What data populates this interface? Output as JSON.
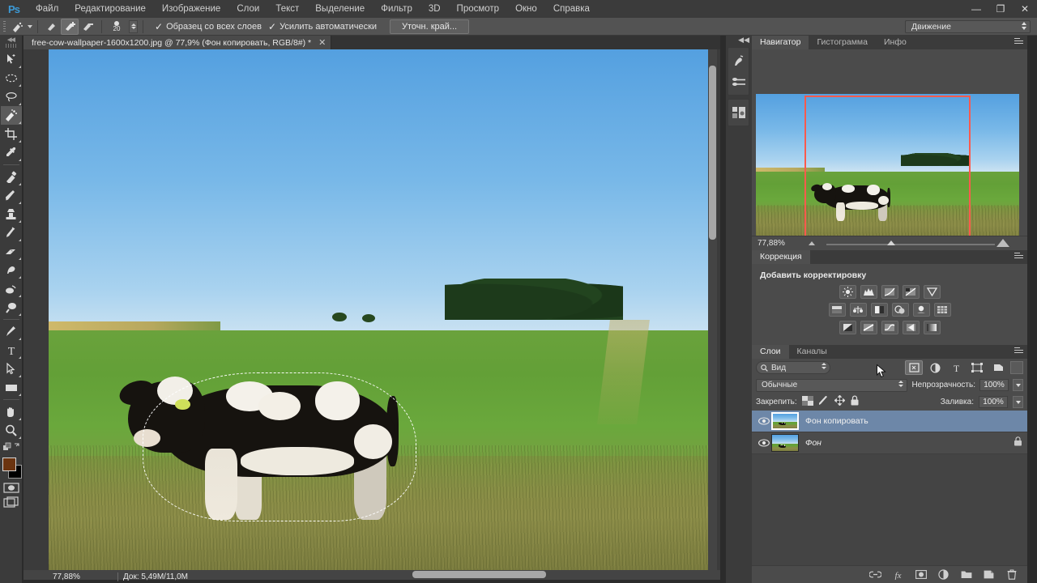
{
  "app": {
    "logo": "Ps",
    "workspace": "Движение"
  },
  "menubar": {
    "items": [
      {
        "label": "Файл"
      },
      {
        "label": "Редактирование"
      },
      {
        "label": "Изображение"
      },
      {
        "label": "Слои"
      },
      {
        "label": "Текст"
      },
      {
        "label": "Выделение"
      },
      {
        "label": "Фильтр"
      },
      {
        "label": "3D"
      },
      {
        "label": "Просмотр"
      },
      {
        "label": "Окно"
      },
      {
        "label": "Справка"
      }
    ]
  },
  "window_controls": {
    "minimize": "—",
    "restore": "❐",
    "close": "✕"
  },
  "options_bar": {
    "brush_size": "20",
    "checkbox_sample_all_layers": "Образец со всех слоев",
    "checkbox_auto_enhance": "Усилить автоматически",
    "refine_edge_button": "Уточн. край...",
    "checkmark": "✓",
    "modes": [
      "quick-selection-new",
      "quick-selection-add",
      "quick-selection-subtract"
    ]
  },
  "toolbar": {
    "tools": [
      {
        "name": "move-tool",
        "label": "Перемещение"
      },
      {
        "name": "marquee-tool",
        "label": "Прямоугольная область"
      },
      {
        "name": "lasso-tool",
        "label": "Лассо"
      },
      {
        "name": "quick-selection-tool",
        "label": "Быстрое выделение",
        "active": true
      },
      {
        "name": "crop-tool",
        "label": "Рамка"
      },
      {
        "name": "eyedropper-tool",
        "label": "Пипетка"
      },
      {
        "name": "healing-brush-tool",
        "label": "Восстанавливающая кисть"
      },
      {
        "name": "brush-tool",
        "label": "Кисть"
      },
      {
        "name": "clone-stamp-tool",
        "label": "Штамп"
      },
      {
        "name": "history-brush-tool",
        "label": "Архивная кисть"
      },
      {
        "name": "eraser-tool",
        "label": "Ластик"
      },
      {
        "name": "gradient-tool",
        "label": "Градиент"
      },
      {
        "name": "blur-tool",
        "label": "Размытие"
      },
      {
        "name": "dodge-tool",
        "label": "Осветлитель"
      },
      {
        "name": "pen-tool",
        "label": "Перо"
      },
      {
        "name": "type-tool",
        "label": "Текст"
      },
      {
        "name": "path-selection-tool",
        "label": "Выделение контура"
      },
      {
        "name": "shape-tool",
        "label": "Прямоугольник"
      },
      {
        "name": "hand-tool",
        "label": "Рука"
      },
      {
        "name": "zoom-tool",
        "label": "Масштаб"
      }
    ],
    "foreground_color": "#6b3410",
    "background_color": "#000000"
  },
  "document": {
    "tab_title": "free-cow-wallpaper-1600x1200.jpg @ 77,9% (Фон копировать, RGB/8#) *",
    "close_glyph": "✕"
  },
  "status_bar": {
    "zoom": "77,88%",
    "doc_size": "Док: 5,49М/11,0М"
  },
  "navigator": {
    "tabs": [
      {
        "label": "Навигатор",
        "active": true
      },
      {
        "label": "Гистограмма",
        "active": false
      },
      {
        "label": "Инфо",
        "active": false
      }
    ],
    "zoom_value": "77,88%",
    "view_rect_color": "#ff5a4d"
  },
  "corrections": {
    "tab": "Коррекция",
    "title": "Добавить корректировку",
    "rows": [
      [
        "brightness-contrast-icon",
        "levels-icon",
        "curves-icon",
        "exposure-icon",
        "vibrance-icon"
      ],
      [
        "hue-saturation-icon",
        "color-balance-icon",
        "black-white-icon",
        "photo-filter-icon",
        "channel-mixer-icon",
        "color-lookup-icon"
      ],
      [
        "invert-icon",
        "posterize-icon",
        "threshold-icon",
        "selective-color-icon",
        "gradient-map-icon"
      ]
    ]
  },
  "layers_panel": {
    "tabs": [
      {
        "label": "Слои",
        "active": true
      },
      {
        "label": "Каналы",
        "active": false
      }
    ],
    "filter_label": "Вид",
    "filter_icons": [
      "pixel-filter-icon",
      "adjustment-filter-icon",
      "type-filter-icon",
      "shape-filter-icon",
      "smart-object-filter-icon"
    ],
    "blend_mode": "Обычные",
    "opacity_label": "Непрозрачность:",
    "opacity_value": "100%",
    "lock_label": "Закрепить:",
    "fill_label": "Заливка:",
    "fill_value": "100%",
    "layers": [
      {
        "name": "Фон копировать",
        "selected": true,
        "visible": true,
        "locked": false,
        "thumb_active": true
      },
      {
        "name": "Фон",
        "selected": false,
        "visible": true,
        "locked": true,
        "thumb_active": false
      }
    ],
    "bottom_icons": [
      "link-layers-icon",
      "layer-style-icon",
      "layer-mask-icon",
      "new-adjustment-icon",
      "new-group-icon",
      "new-layer-icon",
      "delete-layer-icon"
    ]
  },
  "colors": {
    "panel_bg": "#4b4b4b",
    "chrome_bg": "#3b3b3b",
    "selection_blue": "#6d87a8",
    "accent_red": "#ff5a4d",
    "logo_blue": "#3c9ad6"
  }
}
